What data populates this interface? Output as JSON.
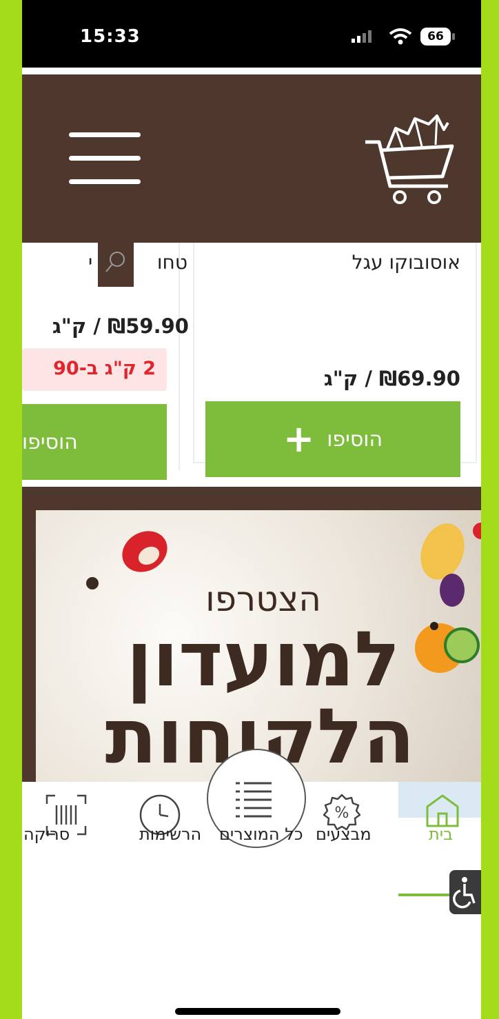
{
  "status_bar": {
    "time": "15:33",
    "battery": "66"
  },
  "header": {
    "menu_icon": "hamburger-icon",
    "cart_icon": "shopping-cart-icon"
  },
  "products": [
    {
      "name": "אוסובוקו עגל",
      "price": "₪69.90 / ק\"ג",
      "add_label": "הוסיפו"
    },
    {
      "name": "טחו",
      "name_tail": "י",
      "price": "₪59.90 / ק\"ג",
      "promo": "2 ק\"ג ב-90",
      "add_label": "הוסיפו"
    }
  ],
  "banner": {
    "line1": "הצטרפו",
    "line2": "למועדון",
    "line3": "הלקוחות"
  },
  "nav": {
    "items": [
      {
        "label": "בית",
        "icon": "home-icon"
      },
      {
        "label": "מבצעים",
        "icon": "percent-badge-icon"
      },
      {
        "label": "כל המוצרים",
        "icon": "list-icon"
      },
      {
        "label": "הרשימות",
        "icon": "clock-icon"
      },
      {
        "label": "סריקה",
        "icon": "barcode-icon"
      }
    ]
  },
  "colors": {
    "brand_brown": "#4e382e",
    "accent_green": "#7ebd3c",
    "promo_red": "#e0262c",
    "frame": "#a3dd1a"
  }
}
